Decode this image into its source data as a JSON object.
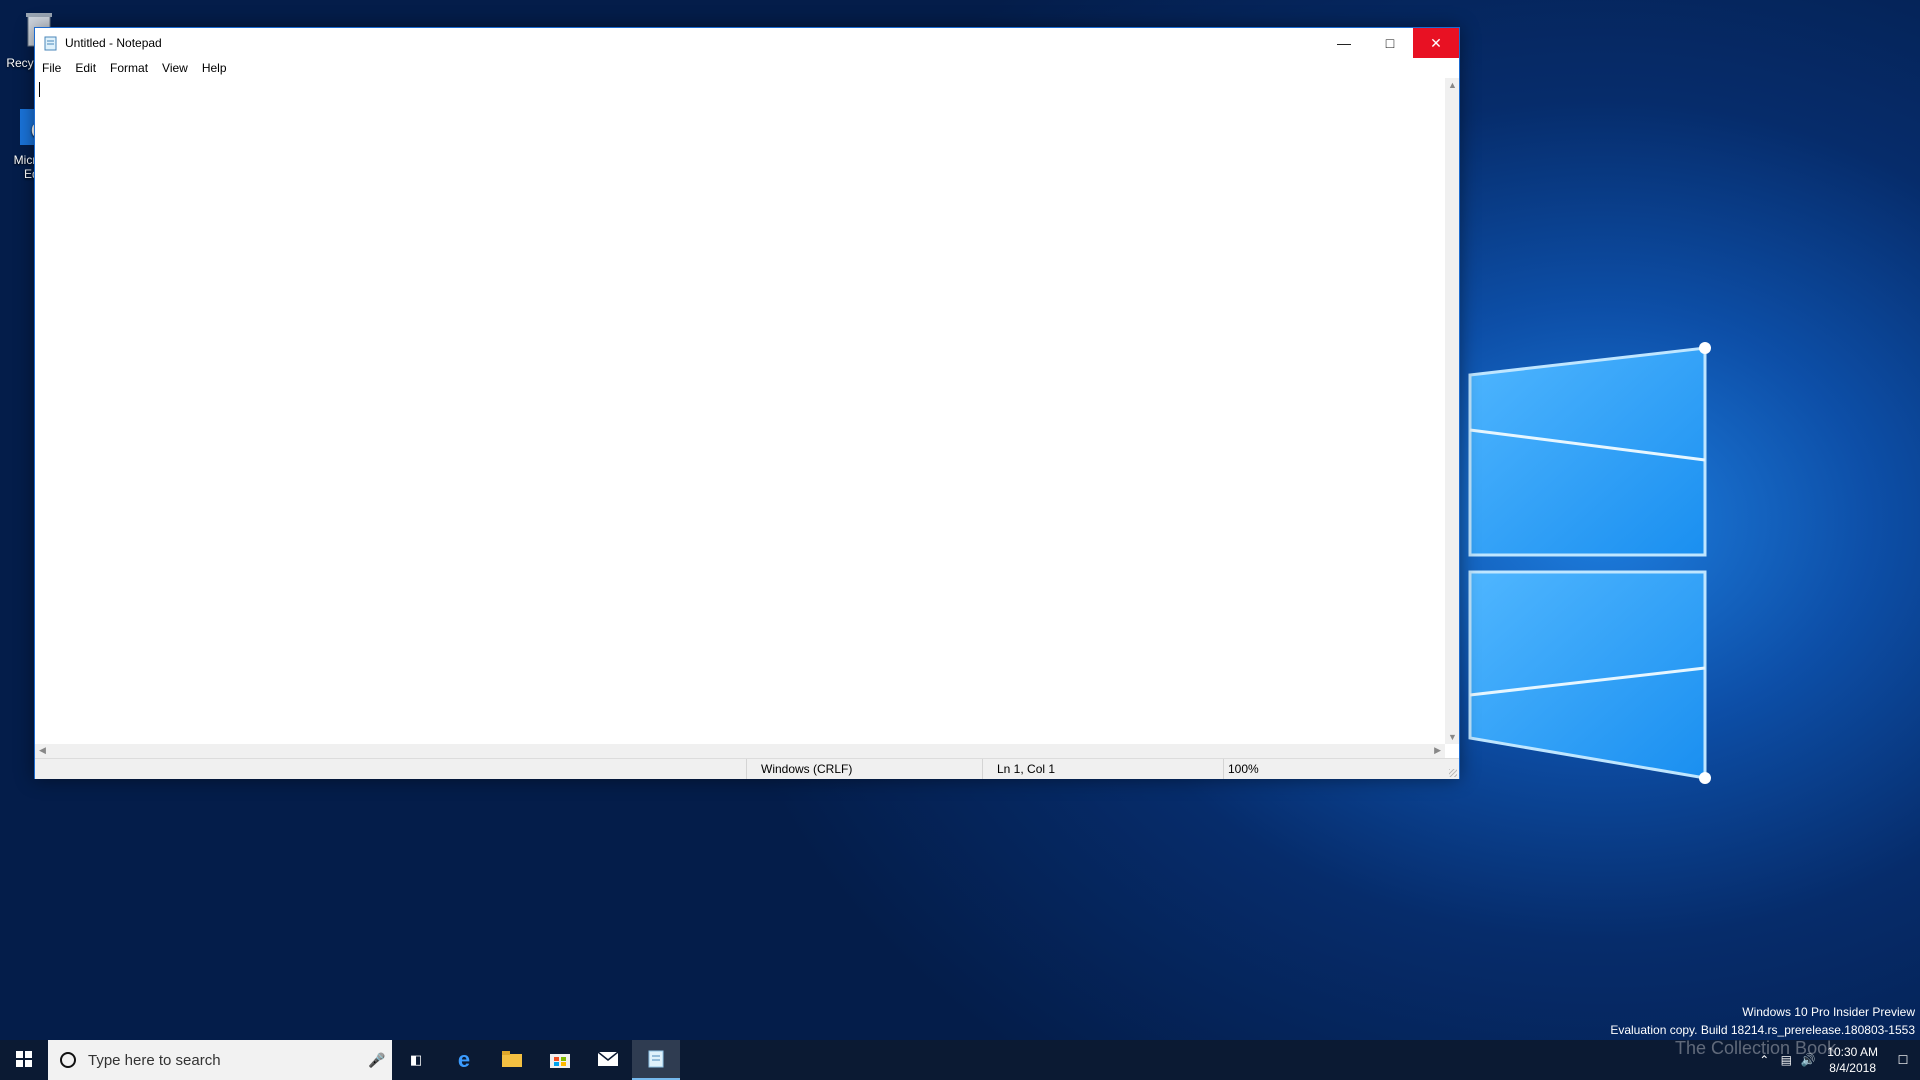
{
  "desktop": {
    "icons": [
      {
        "label": "Recycle Bin"
      },
      {
        "label": "Microsoft Edge"
      }
    ],
    "watermark": {
      "line1": "Windows 10 Pro Insider Preview",
      "line2": "Evaluation copy. Build 18214.rs_prerelease.180803-1553"
    },
    "overlay_text": "The Collection Book"
  },
  "notepad": {
    "title": "Untitled - Notepad",
    "menu": [
      "File",
      "Edit",
      "Format",
      "View",
      "Help"
    ],
    "content": "",
    "status": {
      "line_endings": "Windows (CRLF)",
      "position": "Ln 1, Col 1",
      "zoom": "100%"
    }
  },
  "taskbar": {
    "search_placeholder": "Type here to search",
    "apps": [
      "task-view-icon",
      "edge-icon",
      "file-explorer-icon",
      "store-icon",
      "mail-icon",
      "notepad-icon"
    ],
    "active_app": "notepad-icon",
    "clock": {
      "time": "10:30 AM",
      "date": "8/4/2018"
    }
  },
  "colors": {
    "close_button": "#e81123",
    "taskbar": "#0b1a33",
    "window_border": "#1c6bd0"
  }
}
